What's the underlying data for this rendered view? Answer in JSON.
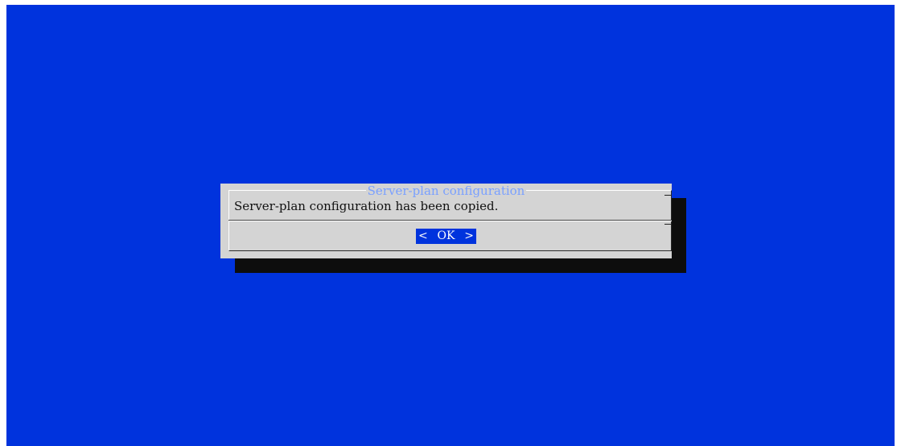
{
  "dialog": {
    "title": "Server-plan configuration",
    "message": "Server-plan configuration has been copied.",
    "ok_button": {
      "left_bracket": "<",
      "label": "OK",
      "right_bracket": ">"
    }
  },
  "colors": {
    "screen_background": "#0033dd",
    "dialog_background": "#d4d4d4",
    "title_text": "#7aa0ff",
    "button_background": "#0033dd",
    "shadow": "#0d0d0d"
  }
}
